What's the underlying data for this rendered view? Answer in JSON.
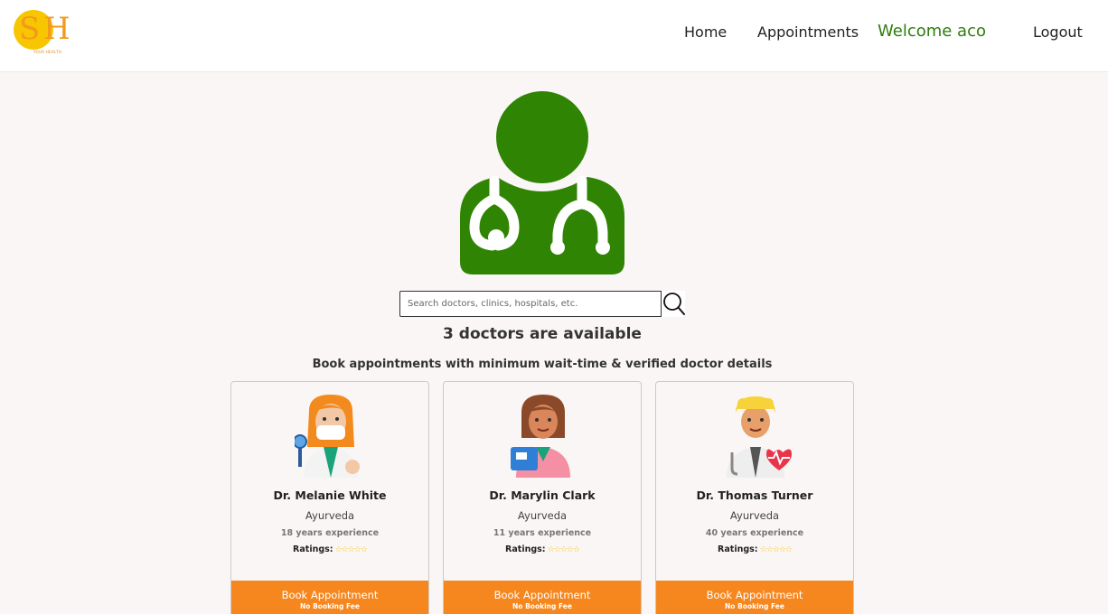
{
  "header": {
    "logo_initials_1": "S",
    "logo_initials_2": "H",
    "logo_tagline": "YOUR HEALTH",
    "nav": {
      "home": "Home",
      "appointments": "Appointments",
      "welcome": "Welcome aco",
      "logout": "Logout"
    }
  },
  "hero_icon": "doctor-stethoscope-icon",
  "search": {
    "placeholder": "Search doctors, clinics, hospitals, etc.",
    "value": "",
    "icon": "search-icon"
  },
  "summary": {
    "count_text": "3 doctors are available",
    "subtitle": "Book appointments with minimum wait-time & verified doctor details"
  },
  "doctors": [
    {
      "name": "Dr. Melanie White",
      "specialty": "Ayurveda",
      "experience": "18 years experience",
      "ratings_label": "Ratings:",
      "stars": "☆☆☆☆☆",
      "button_label": "Book Appointment",
      "button_sub": "No Booking Fee",
      "avatar": "female-doctor-mask-icon"
    },
    {
      "name": "Dr. Marylin Clark",
      "specialty": "Ayurveda",
      "experience": "11 years experience",
      "ratings_label": "Ratings:",
      "stars": "☆☆☆☆☆",
      "button_label": "Book Appointment",
      "button_sub": "No Booking Fee",
      "avatar": "female-doctor-clipboard-icon"
    },
    {
      "name": "Dr. Thomas Turner",
      "specialty": "Ayurveda",
      "experience": "40 years experience",
      "ratings_label": "Ratings:",
      "stars": "☆☆☆☆☆",
      "button_label": "Book Appointment",
      "button_sub": "No Booking Fee",
      "avatar": "male-doctor-heart-icon"
    }
  ],
  "colors": {
    "brand_green": "#2e7d0e",
    "hero_green": "#2f8503",
    "button_orange": "#f6871f",
    "logo_yellow": "#f7c600",
    "logo_orange": "#f29a1b",
    "background": "#faf6f5"
  }
}
